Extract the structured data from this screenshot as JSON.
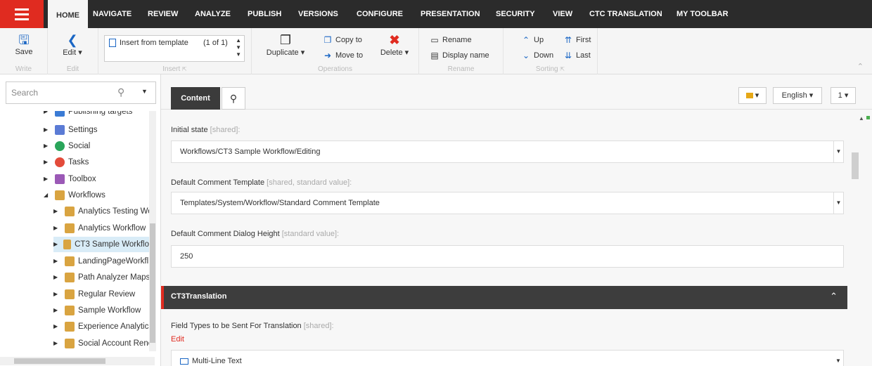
{
  "topbar": {
    "tabs": [
      "HOME",
      "NAVIGATE",
      "REVIEW",
      "ANALYZE",
      "PUBLISH",
      "VERSIONS",
      "CONFIGURE",
      "PRESENTATION",
      "SECURITY",
      "VIEW",
      "CTC TRANSLATION",
      "MY TOOLBAR"
    ],
    "active_tab": "HOME"
  },
  "ribbon": {
    "save": "Save",
    "write_caption": "Write",
    "edit": "Edit ▾",
    "edit_caption": "Edit",
    "insert_item": "Insert from template",
    "insert_count": "(1 of 1)",
    "insert_caption": "Insert",
    "duplicate": "Duplicate ▾",
    "copy_to": "Copy to",
    "move_to": "Move to",
    "delete": "Delete ▾",
    "operations_caption": "Operations",
    "rename": "Rename",
    "display_name": "Display name",
    "rename_caption": "Rename",
    "up": "Up",
    "down": "Down",
    "first": "First",
    "last": "Last",
    "sorting_caption": "Sorting"
  },
  "search": {
    "placeholder": "Search"
  },
  "tree": [
    {
      "label": "Publishing targets",
      "color": "#3a7bd5"
    },
    {
      "label": "Settings",
      "color": "#5b7bd5"
    },
    {
      "label": "Social",
      "color": "#2aa55a"
    },
    {
      "label": "Tasks",
      "color": "#e34b3a"
    },
    {
      "label": "Toolbox",
      "color": "#9b59b6"
    },
    {
      "label": "Workflows",
      "color": "#d9a441"
    },
    {
      "label": "Analytics Testing Wo",
      "color": "#d9a441"
    },
    {
      "label": "Analytics Workflow",
      "color": "#d9a441"
    },
    {
      "label": "CT3 Sample Workflo",
      "color": "#d9a441"
    },
    {
      "label": "LandingPageWorkfl",
      "color": "#d9a441"
    },
    {
      "label": "Path Analyzer Maps",
      "color": "#d9a441"
    },
    {
      "label": "Regular Review",
      "color": "#d9a441"
    },
    {
      "label": "Sample Workflow",
      "color": "#d9a441"
    },
    {
      "label": "Experience Analytics",
      "color": "#d9a441"
    },
    {
      "label": "Social Account Rene",
      "color": "#d9a441"
    }
  ],
  "content": {
    "tab_label": "Content",
    "language": "English ▾",
    "version": "1 ▾",
    "fields": [
      {
        "label": "Initial state",
        "hint": "[shared]:",
        "value": "Workflows/CT3 Sample Workflow/Editing"
      },
      {
        "label": "Default Comment Template",
        "hint": "[shared, standard value]:",
        "value": "Templates/System/Workflow/Standard Comment Template"
      },
      {
        "label": "Default Comment Dialog Height",
        "hint": "[standard value]:",
        "value": "250"
      }
    ],
    "section_title": "CT3Translation",
    "translation_field_label": "Field Types to be Sent For Translation",
    "translation_field_hint": "[shared]:",
    "edit_link": "Edit",
    "multiline_item": "Multi-Line Text"
  }
}
